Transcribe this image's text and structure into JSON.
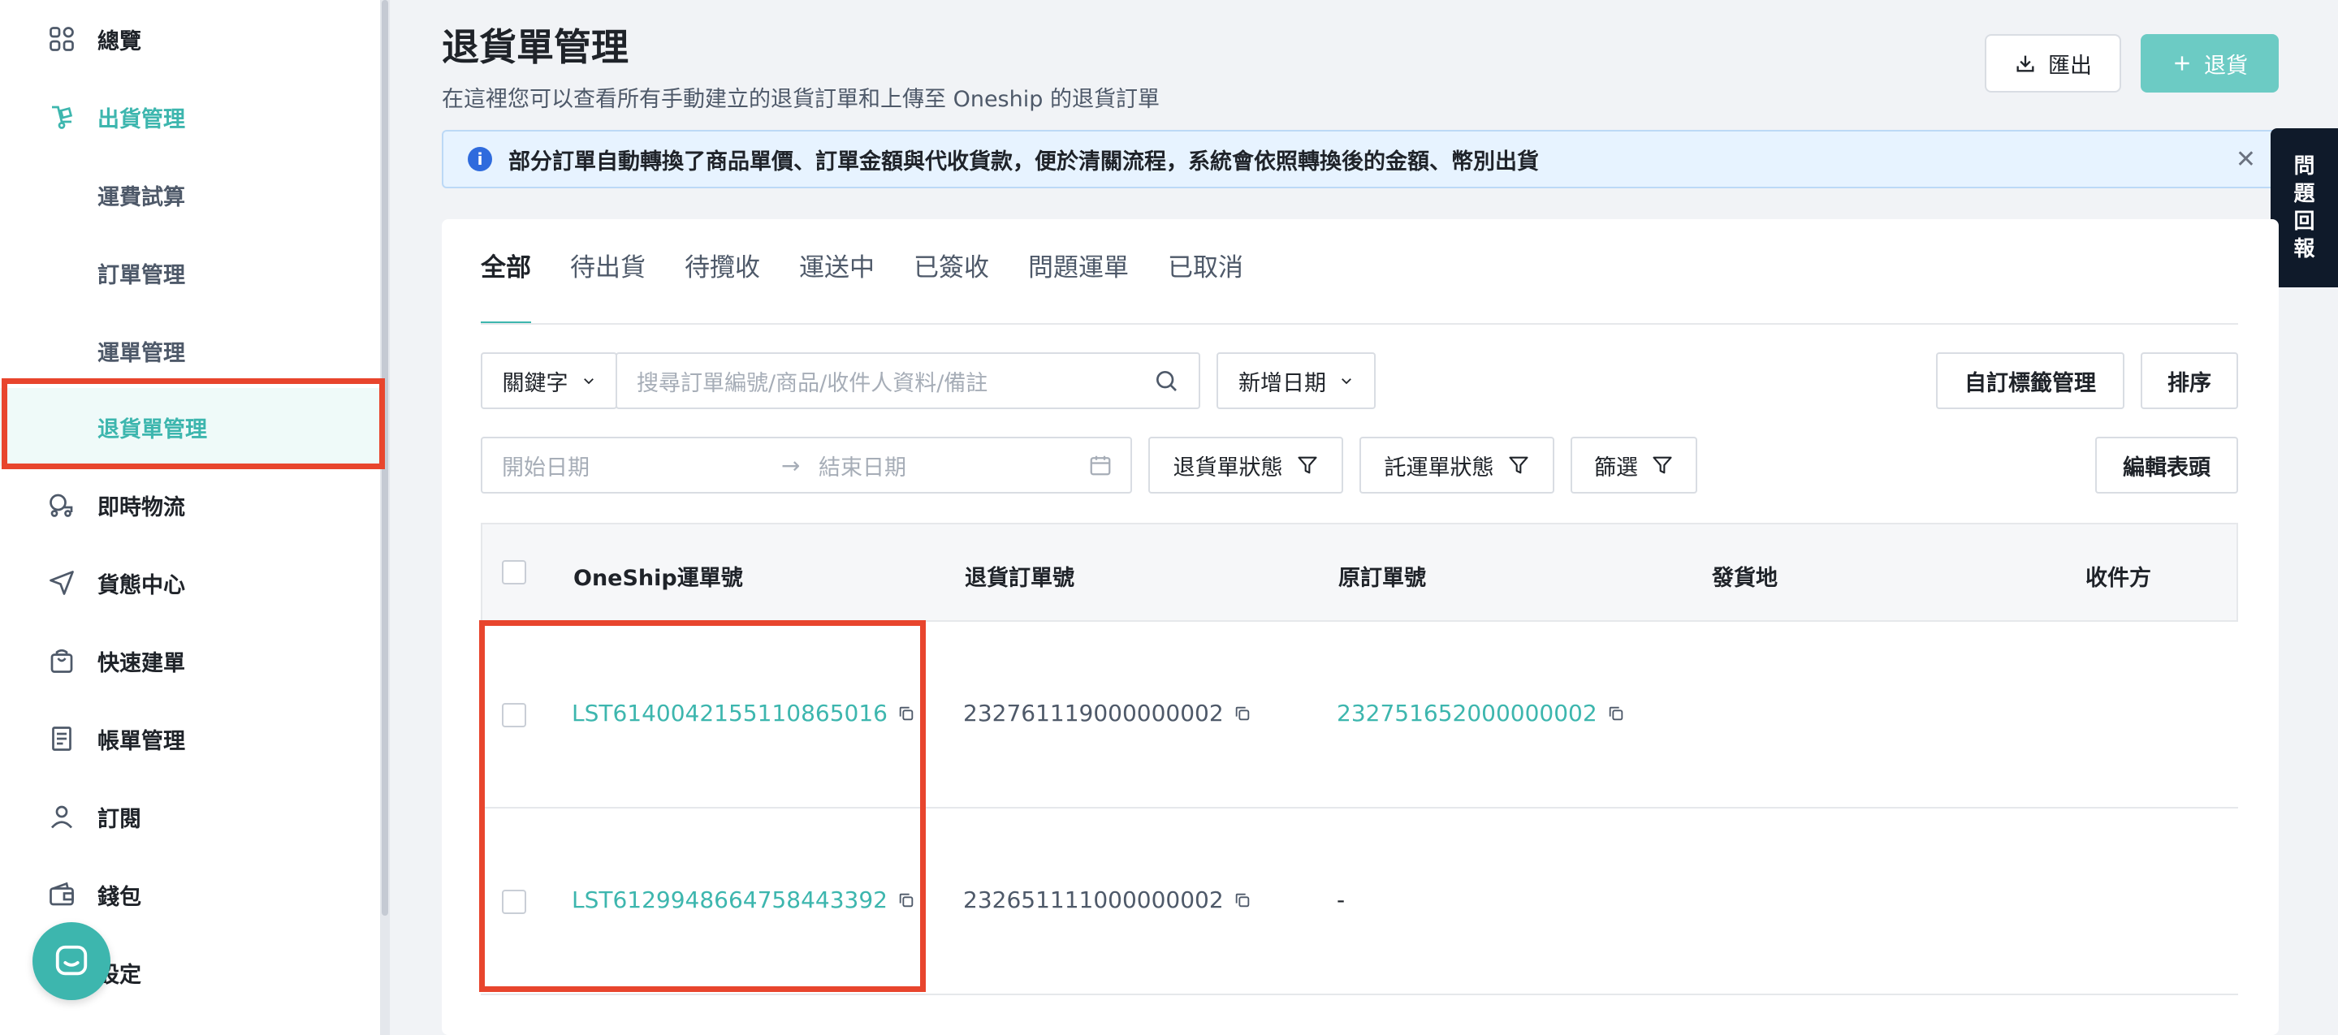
{
  "sidebar": {
    "items": [
      {
        "label": "總覽",
        "icon": "dashboard-icon"
      },
      {
        "label": "出貨管理",
        "icon": "shipping-icon"
      },
      {
        "label": "運費試算"
      },
      {
        "label": "訂單管理"
      },
      {
        "label": "運單管理"
      },
      {
        "label": "退貨單管理"
      },
      {
        "label": "即時物流",
        "icon": "delivery-icon"
      },
      {
        "label": "貨態中心",
        "icon": "send-icon"
      },
      {
        "label": "快速建單",
        "icon": "bag-icon"
      },
      {
        "label": "帳單管理",
        "icon": "bill-icon"
      },
      {
        "label": "訂閱",
        "icon": "user-icon"
      },
      {
        "label": "錢包",
        "icon": "wallet-icon"
      },
      {
        "label": "設定",
        "icon": "gear-icon"
      }
    ]
  },
  "header": {
    "title": "退貨單管理",
    "subtitle": "在這裡您可以查看所有手動建立的退貨訂單和上傳至 Oneship 的退貨訂單",
    "export_label": "匯出",
    "return_label": "退貨"
  },
  "notice": {
    "text": "部分訂單自動轉換了商品單價、訂單金額與代收貨款，便於清關流程，系統會依照轉換後的金額、幣別出貨"
  },
  "feedback": {
    "chars": [
      "問",
      "題",
      "回",
      "報"
    ]
  },
  "tabs": [
    "全部",
    "待出貨",
    "待攬收",
    "運送中",
    "已簽收",
    "問題運單",
    "已取消"
  ],
  "filters": {
    "keyword_label": "關鍵字",
    "search_placeholder": "搜尋訂單編號/商品/收件人資料/備註",
    "date_type_label": "新增日期",
    "custom_tag_label": "自訂標籤管理",
    "sort_label": "排序",
    "start_date_placeholder": "開始日期",
    "end_date_placeholder": "結束日期",
    "return_status_label": "退貨單狀態",
    "waybill_status_label": "託運單狀態",
    "filter_label": "篩選",
    "edit_columns_label": "編輯表頭"
  },
  "table": {
    "columns": [
      "OneShip運單號",
      "退貨訂單號",
      "原訂單號",
      "發貨地",
      "收件方"
    ],
    "rows": [
      {
        "oneship": "LST6140042155110865016",
        "return_no": "232761119000000002",
        "original_no": "232751652000000002"
      },
      {
        "oneship": "LST6129948664758443392",
        "return_no": "232651111000000002",
        "original_no": "-"
      }
    ]
  },
  "colors": {
    "accent": "#3db6ae",
    "highlight": "#e8452d"
  }
}
